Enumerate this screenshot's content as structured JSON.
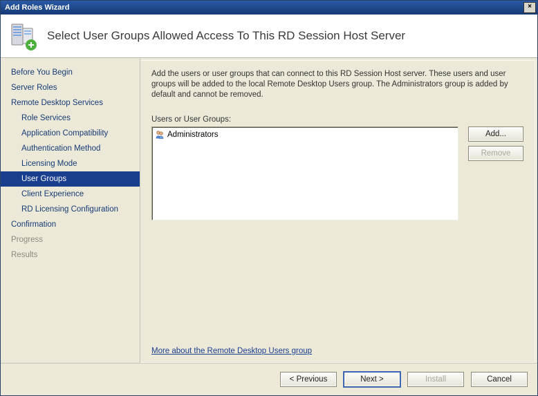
{
  "window": {
    "title": "Add Roles Wizard"
  },
  "header": {
    "title": "Select User Groups Allowed Access To This RD Session Host Server"
  },
  "nav": {
    "items": [
      {
        "label": "Before You Begin",
        "sub": false
      },
      {
        "label": "Server Roles",
        "sub": false
      },
      {
        "label": "Remote Desktop Services",
        "sub": false
      },
      {
        "label": "Role Services",
        "sub": true
      },
      {
        "label": "Application Compatibility",
        "sub": true
      },
      {
        "label": "Authentication Method",
        "sub": true
      },
      {
        "label": "Licensing Mode",
        "sub": true
      },
      {
        "label": "User Groups",
        "sub": true,
        "selected": true
      },
      {
        "label": "Client Experience",
        "sub": true
      },
      {
        "label": "RD Licensing Configuration",
        "sub": true
      },
      {
        "label": "Confirmation",
        "sub": false
      },
      {
        "label": "Progress",
        "sub": false,
        "disabled": true
      },
      {
        "label": "Results",
        "sub": false,
        "disabled": true
      }
    ]
  },
  "content": {
    "description": "Add the users or user groups that can connect to this RD Session Host server. These users and user groups will be added to the local Remote Desktop Users group. The Administrators group is added by default and cannot be removed.",
    "list_label": "Users or User Groups:",
    "list_items": [
      {
        "label": "Administrators"
      }
    ],
    "buttons": {
      "add": "Add...",
      "remove": "Remove"
    },
    "help_link": "More about the Remote Desktop Users group"
  },
  "footer": {
    "previous": "< Previous",
    "next": "Next >",
    "install": "Install",
    "cancel": "Cancel"
  }
}
